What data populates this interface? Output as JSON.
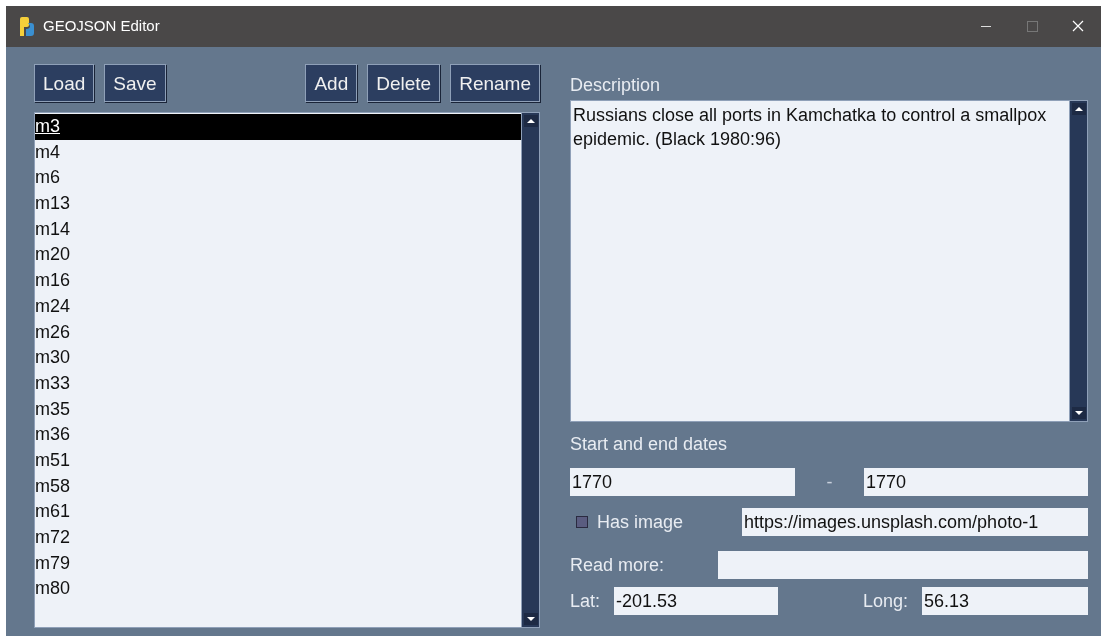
{
  "window": {
    "title": "GEOJSON Editor"
  },
  "toolbar": {
    "left_buttons": [
      "Load",
      "Save"
    ],
    "right_buttons": [
      "Add",
      "Delete",
      "Rename"
    ]
  },
  "markers": [
    {
      "name": "m3",
      "selected": true
    },
    {
      "name": "m4",
      "selected": false
    },
    {
      "name": "m6",
      "selected": false
    },
    {
      "name": "m13",
      "selected": false
    },
    {
      "name": "m14",
      "selected": false
    },
    {
      "name": "m20",
      "selected": false
    },
    {
      "name": "m16",
      "selected": false
    },
    {
      "name": "m24",
      "selected": false
    },
    {
      "name": "m26",
      "selected": false
    },
    {
      "name": "m30",
      "selected": false
    },
    {
      "name": "m33",
      "selected": false
    },
    {
      "name": "m35",
      "selected": false
    },
    {
      "name": "m36",
      "selected": false
    },
    {
      "name": "m51",
      "selected": false
    },
    {
      "name": "m58",
      "selected": false
    },
    {
      "name": "m61",
      "selected": false
    },
    {
      "name": "m72",
      "selected": false
    },
    {
      "name": "m79",
      "selected": false
    },
    {
      "name": "m80",
      "selected": false
    }
  ],
  "description": {
    "label": "Description",
    "value": "Russians close all ports in Kamchatka to control a smallpox epidemic. (Black 1980:96)"
  },
  "dates": {
    "label": "Start and end dates",
    "start": "1770",
    "separator": "-",
    "end": "1770"
  },
  "image": {
    "label": "Has image",
    "checked": false,
    "url": "https://images.unsplash.com/photo-1"
  },
  "read_more": {
    "label": "Read more:"
  },
  "coordinates": {
    "lat_label": "Lat:",
    "lat": "-201.53",
    "long_label": "Long:",
    "long": "56.13"
  }
}
